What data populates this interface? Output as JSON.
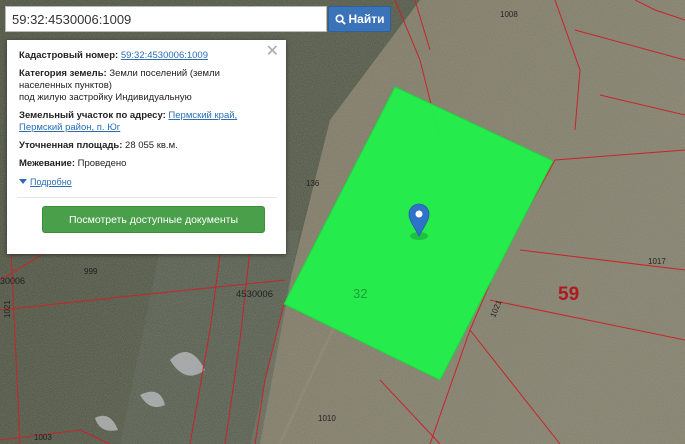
{
  "search": {
    "value": "59:32:4530006:1009",
    "button_label": "Найти"
  },
  "panel": {
    "cadastral_label": "Кадастровый номер:",
    "cadastral_value": "59:32:4530006:1009",
    "category_label": "Категория земель:",
    "category_value": "Земли поселений (земли населенных пунктов)",
    "usage_value": "под жилую застройку Индивидуальную",
    "address_label": "Земельный участок по адресу:",
    "address_value": "Пермский край, Пермский район, п. Юг",
    "area_label": "Уточненная площадь:",
    "area_value": "28 055 кв.м.",
    "survey_label": "Межевание:",
    "survey_value": "Проведено",
    "more_label": "Подробно",
    "docs_button": "Посмотреть доступные документы"
  },
  "map_labels": {
    "l1008": "1008",
    "l136": "136",
    "l999": "999",
    "l1017": "1017",
    "l1021": "1021",
    "l1010": "1010",
    "l1003": "1003",
    "l1021_left": "1021",
    "quarter": "4530006",
    "quarter_left": "30006",
    "big59": "59",
    "plot32": "32"
  },
  "colors": {
    "parcel": "#22ee4a",
    "boundary": "#c8242a",
    "marker": "#2f72c9",
    "button_green": "#4aa04a",
    "search_blue": "#3b73b9"
  }
}
